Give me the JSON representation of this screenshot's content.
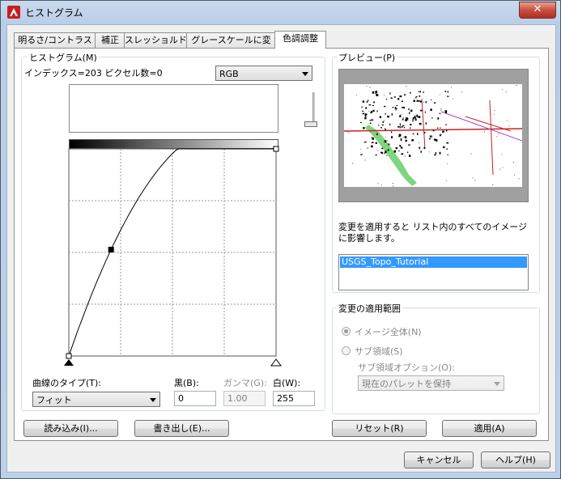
{
  "window": {
    "title": "ヒストグラム",
    "close_glyph": "✕"
  },
  "tabs": [
    {
      "label": "明るさ/コントラスト"
    },
    {
      "label": "補正"
    },
    {
      "label": "スレッショルド"
    },
    {
      "label": "グレースケールに変換"
    },
    {
      "label": "色調調整"
    }
  ],
  "histogram": {
    "group_label": "ヒストグラム(M)",
    "info": "インデックス=203  ピクセル数=0",
    "channel_select": "RGB"
  },
  "curve": {
    "control_points": [
      {
        "input": 0,
        "output": 0
      },
      {
        "input": 52,
        "output": 131
      },
      {
        "input": 255,
        "output": 255
      }
    ],
    "curve_type_label": "曲線のタイプ(T):",
    "curve_type_value": "フィット",
    "black_label": "黒(B):",
    "black_value": "0",
    "gamma_label": "ガンマ(G):",
    "gamma_value": "1.00",
    "white_label": "白(W):",
    "white_value": "255"
  },
  "preview": {
    "group_label": "プレビュー(P)",
    "note": "変更を適用すると リスト内のすべてのイメージに影響します。",
    "list_items": [
      "USGS_Topo_Tutorial"
    ]
  },
  "apply_scope": {
    "group_label": "変更の適用範囲",
    "whole_image_label": "イメージ全体(N)",
    "subregion_label": "サブ領域(S)",
    "subregion_option_label": "サブ領域オプション(O):",
    "subregion_option_value": "現在のパレットを保持"
  },
  "buttons": {
    "load": "読み込み(I)...",
    "save": "書き出し(E)...",
    "reset": "リセット(R)",
    "apply": "適用(A)",
    "cancel": "キャンセル",
    "help": "ヘルプ(H)"
  },
  "colors": {
    "selection": "#3399ff",
    "close_button": "#c75040"
  }
}
